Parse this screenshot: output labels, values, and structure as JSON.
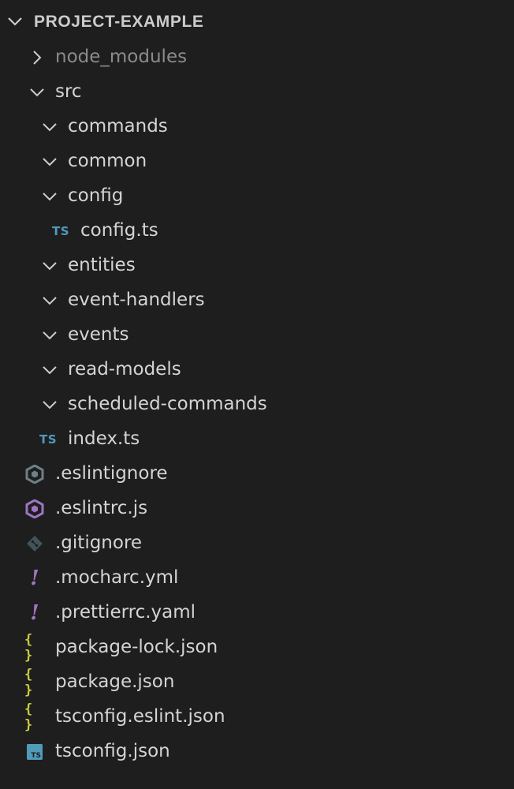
{
  "explorer": {
    "root_title": "PROJECT-EXAMPLE"
  },
  "tree": {
    "node_modules": "node_modules",
    "src": "src",
    "commands": "commands",
    "common": "common",
    "config": "config",
    "config_ts": "config.ts",
    "entities": "entities",
    "event_handlers": "event-handlers",
    "events": "events",
    "read_models": "read-models",
    "scheduled_commands": "scheduled-commands",
    "index_ts": "index.ts",
    "eslintignore": ".eslintignore",
    "eslintrc": ".eslintrc.js",
    "gitignore": ".gitignore",
    "mocharc": ".mocharc.yml",
    "prettierrc": ".prettierrc.yaml",
    "package_lock": "package-lock.json",
    "package_json": "package.json",
    "tsconfig_eslint": "tsconfig.eslint.json",
    "tsconfig": "tsconfig.json"
  },
  "icons": {
    "ts_badge": "TS",
    "yaml_badge": "!",
    "json_badge": "{ }",
    "tsconfig_badge": "TS"
  },
  "colors": {
    "background": "#1e1e1e",
    "text": "#d4d4d4",
    "dimmed_text": "#8b8b8b",
    "typescript": "#519aba",
    "eslint": "#a074c4",
    "eslintignore": "#6d8086",
    "git": "#41535b",
    "yaml": "#a074c4",
    "json": "#cbcb41"
  }
}
